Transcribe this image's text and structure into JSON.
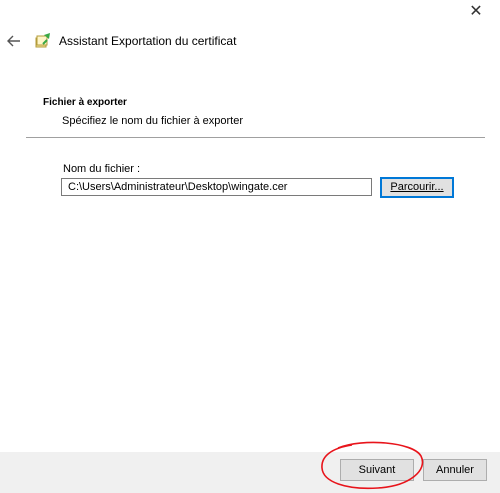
{
  "window": {
    "title": "Assistant Exportation du certificat",
    "close_glyph": "✕"
  },
  "icons": {
    "back": "back-arrow-icon",
    "wizard": "certificate-wizard-icon",
    "close": "close-icon"
  },
  "section": {
    "title": "Fichier à exporter",
    "description": "Spécifiez le nom du fichier à exporter"
  },
  "file": {
    "label": "Nom du fichier :",
    "value": "C:\\Users\\Administrateur\\Desktop\\wingate.cer",
    "browse_label": "Parcourir..."
  },
  "footer": {
    "next_label": "Suivant",
    "cancel_label": "Annuler"
  },
  "colors": {
    "accent": "#0078d7",
    "annotation": "#e8141b",
    "footer_bg": "#f0f0f0"
  }
}
